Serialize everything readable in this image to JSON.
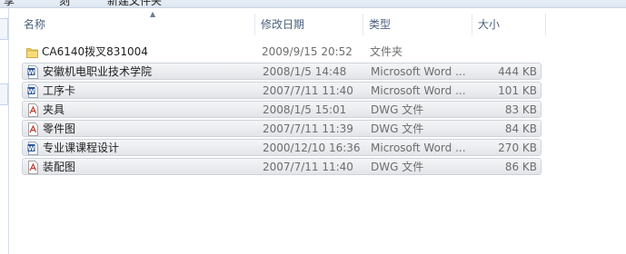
{
  "toolbar": {
    "items": [
      "享",
      "刻",
      "新建文件夹"
    ]
  },
  "columns": {
    "name": "名称",
    "date": "修改日期",
    "type": "类型",
    "size": "大小"
  },
  "files": [
    {
      "name": "CA6140拨叉831004",
      "date": "2009/9/15 20:52",
      "type": "文件夹",
      "size": "",
      "icon": "folder-icon",
      "selected": false
    },
    {
      "name": "安徽机电职业技术学院",
      "date": "2008/1/5 14:48",
      "type": "Microsoft Word ...",
      "size": "444 KB",
      "icon": "word-doc-icon",
      "selected": true
    },
    {
      "name": "工序卡",
      "date": "2007/7/11 11:40",
      "type": "Microsoft Word ...",
      "size": "101 KB",
      "icon": "word-doc-icon",
      "selected": true
    },
    {
      "name": "夹具",
      "date": "2008/1/5 15:01",
      "type": "DWG 文件",
      "size": "83 KB",
      "icon": "dwg-file-icon",
      "selected": true
    },
    {
      "name": "零件图",
      "date": "2007/7/11 11:39",
      "type": "DWG 文件",
      "size": "84 KB",
      "icon": "dwg-file-icon",
      "selected": true
    },
    {
      "name": "专业课课程设计",
      "date": "2000/12/10 16:36",
      "type": "Microsoft Word ...",
      "size": "270 KB",
      "icon": "word-doc-icon",
      "selected": true
    },
    {
      "name": "装配图",
      "date": "2007/7/11 11:40",
      "type": "DWG 文件",
      "size": "86 KB",
      "icon": "dwg-file-icon",
      "selected": true
    }
  ]
}
